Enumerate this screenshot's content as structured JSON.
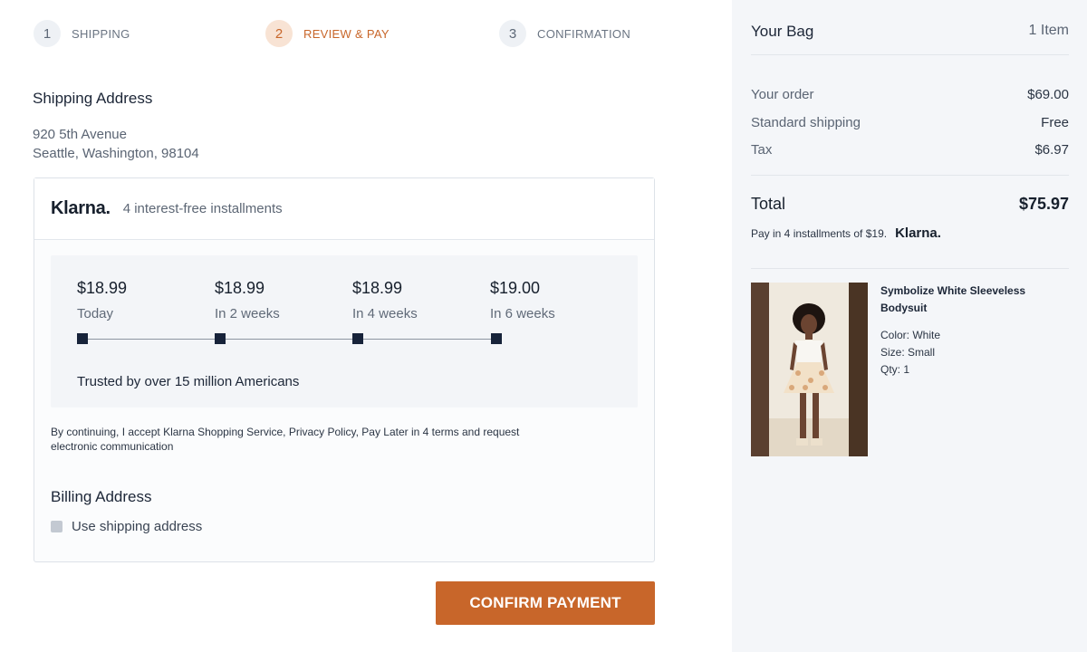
{
  "steps": [
    {
      "num": "1",
      "label": "SHIPPING"
    },
    {
      "num": "2",
      "label": "REVIEW & PAY"
    },
    {
      "num": "3",
      "label": "CONFIRMATION"
    }
  ],
  "shipping": {
    "heading": "Shipping Address",
    "line1": "920 5th Avenue",
    "line2": "Seattle, Washington, 98104"
  },
  "klarna": {
    "logo": "Klarna.",
    "subtitle": "4 interest-free installments",
    "installments": [
      {
        "amount": "$18.99",
        "when": "Today"
      },
      {
        "amount": "$18.99",
        "when": "In 2 weeks"
      },
      {
        "amount": "$18.99",
        "when": "In 4 weeks"
      },
      {
        "amount": "$19.00",
        "when": "In 6 weeks"
      }
    ],
    "trusted": "Trusted by over 15 million Americans",
    "terms": "By continuing, I accept Klarna Shopping Service, Privacy Policy, Pay Later in 4 terms and request electronic communication"
  },
  "billing": {
    "heading": "Billing Address",
    "checkbox_label": "Use shipping address"
  },
  "confirm_label": "CONFIRM PAYMENT",
  "bag": {
    "title": "Your Bag",
    "count": "1 Item",
    "rows": [
      {
        "label": "Your order",
        "value": "$69.00"
      },
      {
        "label": "Standard shipping",
        "value": "Free"
      },
      {
        "label": "Tax",
        "value": "$6.97"
      }
    ],
    "total_label": "Total",
    "total_value": "$75.97",
    "pay_note": "Pay in 4 installments of $19.",
    "pay_note_logo": "Klarna."
  },
  "product": {
    "name": "Symbolize White Sleeveless Bodysuit",
    "color": "Color: White",
    "size": "Size: Small",
    "qty": "Qty: 1"
  },
  "colors": {
    "accent": "#c8662a",
    "sidebar_bg": "#f4f6f9",
    "dark": "#17233a"
  }
}
